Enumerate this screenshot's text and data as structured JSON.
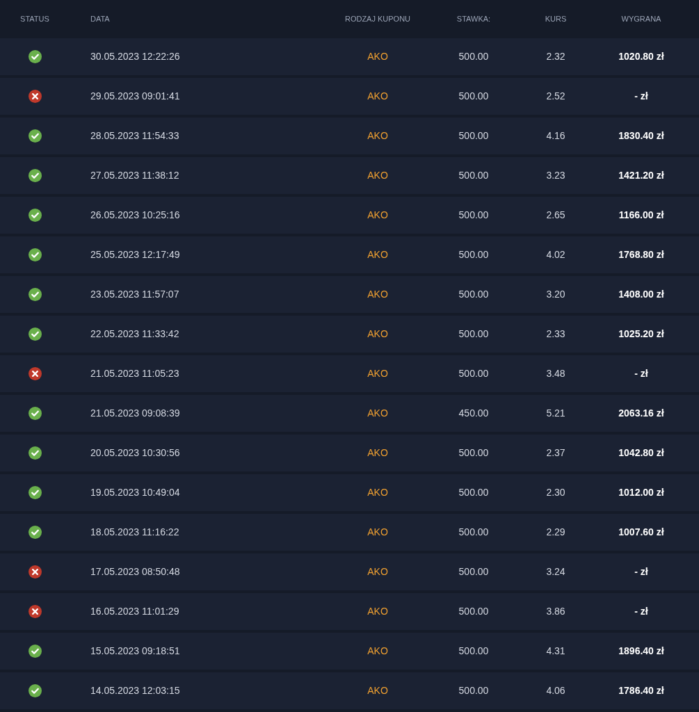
{
  "columns": [
    "STATUS",
    "DATA",
    "RODZAJ KUPONU",
    "STAWKA:",
    "KURS",
    "WYGRANA"
  ],
  "rows": [
    {
      "won": true,
      "date": "30.05.2023 12:22:26",
      "type": "AKO",
      "stake": "500.00",
      "odds": "2.32",
      "win": "1020.80 zł"
    },
    {
      "won": false,
      "date": "29.05.2023 09:01:41",
      "type": "AKO",
      "stake": "500.00",
      "odds": "2.52",
      "win": "- zł"
    },
    {
      "won": true,
      "date": "28.05.2023 11:54:33",
      "type": "AKO",
      "stake": "500.00",
      "odds": "4.16",
      "win": "1830.40 zł"
    },
    {
      "won": true,
      "date": "27.05.2023 11:38:12",
      "type": "AKO",
      "stake": "500.00",
      "odds": "3.23",
      "win": "1421.20 zł"
    },
    {
      "won": true,
      "date": "26.05.2023 10:25:16",
      "type": "AKO",
      "stake": "500.00",
      "odds": "2.65",
      "win": "1166.00 zł"
    },
    {
      "won": true,
      "date": "25.05.2023 12:17:49",
      "type": "AKO",
      "stake": "500.00",
      "odds": "4.02",
      "win": "1768.80 zł"
    },
    {
      "won": true,
      "date": "23.05.2023 11:57:07",
      "type": "AKO",
      "stake": "500.00",
      "odds": "3.20",
      "win": "1408.00 zł"
    },
    {
      "won": true,
      "date": "22.05.2023 11:33:42",
      "type": "AKO",
      "stake": "500.00",
      "odds": "2.33",
      "win": "1025.20 zł"
    },
    {
      "won": false,
      "date": "21.05.2023 11:05:23",
      "type": "AKO",
      "stake": "500.00",
      "odds": "3.48",
      "win": "- zł"
    },
    {
      "won": true,
      "date": "21.05.2023 09:08:39",
      "type": "AKO",
      "stake": "450.00",
      "odds": "5.21",
      "win": "2063.16 zł"
    },
    {
      "won": true,
      "date": "20.05.2023 10:30:56",
      "type": "AKO",
      "stake": "500.00",
      "odds": "2.37",
      "win": "1042.80 zł"
    },
    {
      "won": true,
      "date": "19.05.2023 10:49:04",
      "type": "AKO",
      "stake": "500.00",
      "odds": "2.30",
      "win": "1012.00 zł"
    },
    {
      "won": true,
      "date": "18.05.2023 11:16:22",
      "type": "AKO",
      "stake": "500.00",
      "odds": "2.29",
      "win": "1007.60 zł"
    },
    {
      "won": false,
      "date": "17.05.2023 08:50:48",
      "type": "AKO",
      "stake": "500.00",
      "odds": "3.24",
      "win": "- zł"
    },
    {
      "won": false,
      "date": "16.05.2023 11:01:29",
      "type": "AKO",
      "stake": "500.00",
      "odds": "3.86",
      "win": "- zł"
    },
    {
      "won": true,
      "date": "15.05.2023 09:18:51",
      "type": "AKO",
      "stake": "500.00",
      "odds": "4.31",
      "win": "1896.40 zł"
    },
    {
      "won": true,
      "date": "14.05.2023 12:03:15",
      "type": "AKO",
      "stake": "500.00",
      "odds": "4.06",
      "win": "1786.40 zł"
    }
  ]
}
